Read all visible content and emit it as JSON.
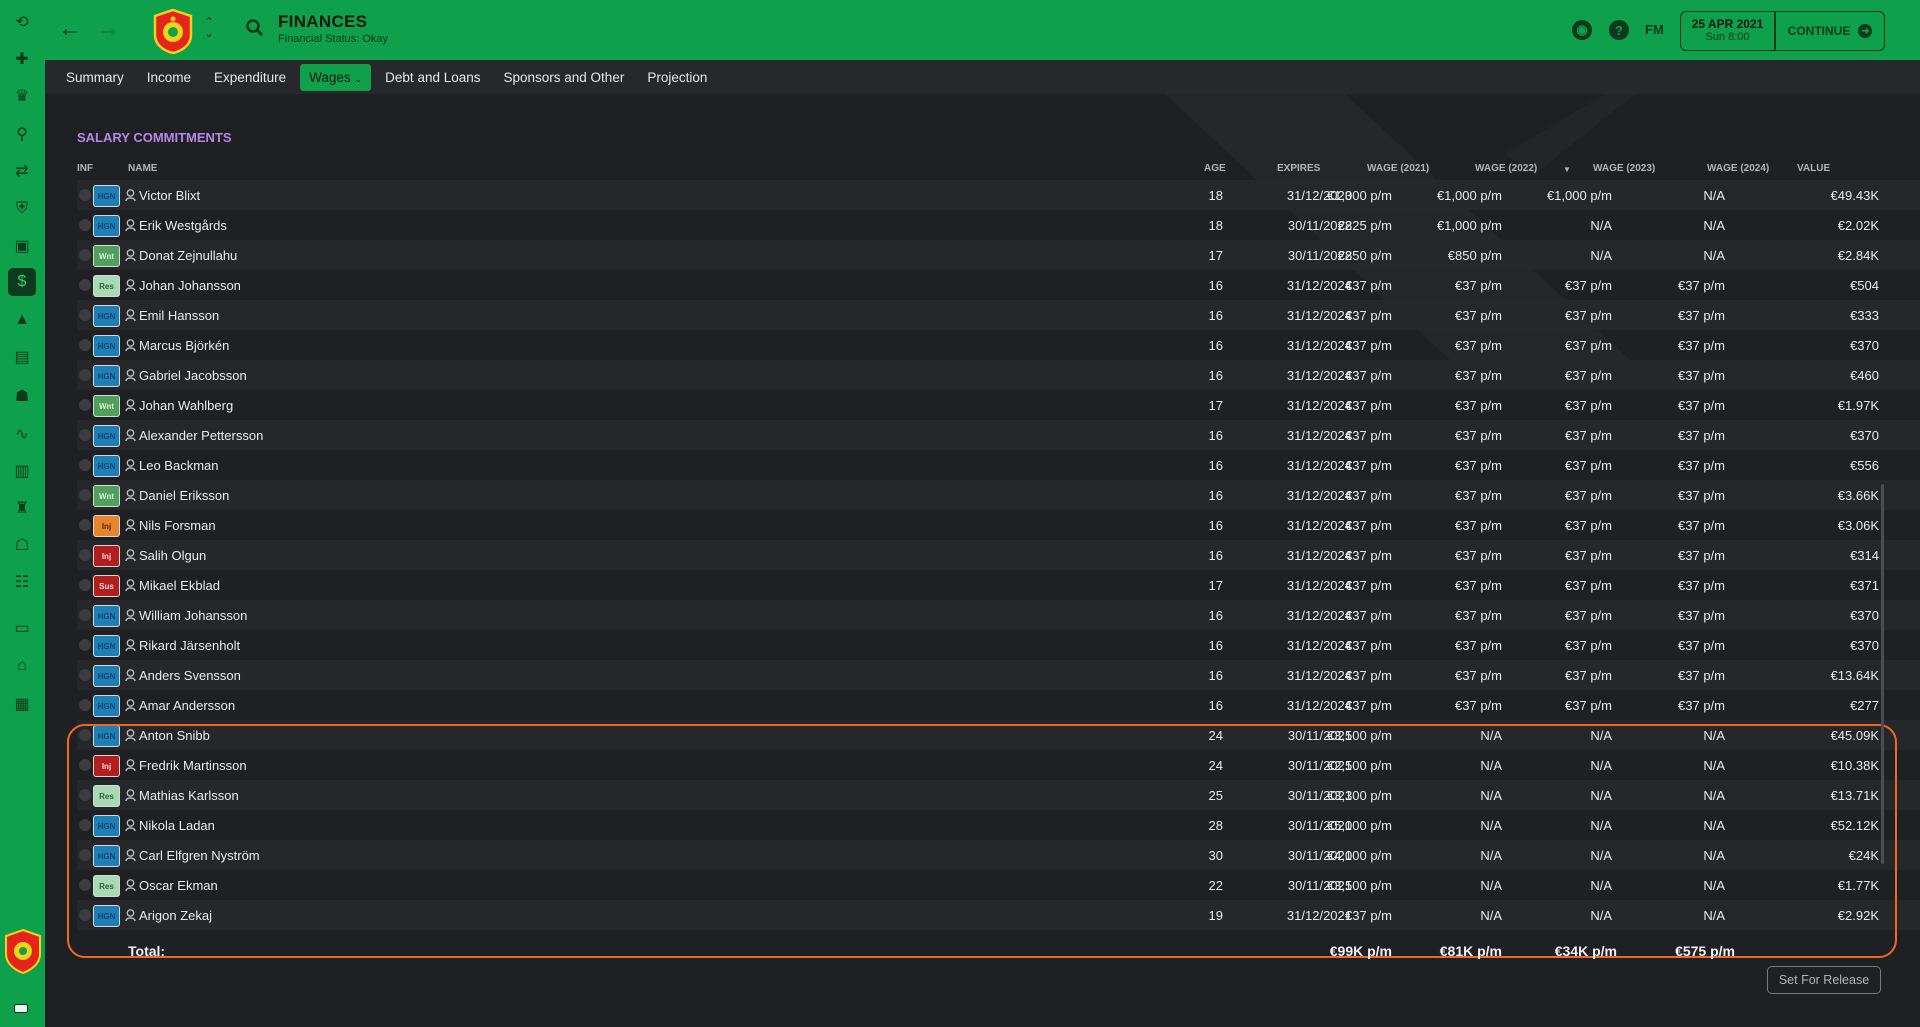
{
  "header": {
    "title": "FINANCES",
    "subtitle": "Financial Status: Okay",
    "fm_logo": "FM",
    "date": "25 APR 2021",
    "time": "Sun 8:00",
    "continue_label": "CONTINUE"
  },
  "tabs": [
    {
      "label": "Summary"
    },
    {
      "label": "Income"
    },
    {
      "label": "Expenditure"
    },
    {
      "label": "Wages"
    },
    {
      "label": "Debt and Loans"
    },
    {
      "label": "Sponsors and Other"
    },
    {
      "label": "Projection"
    }
  ],
  "section_title": "SALARY COMMITMENTS",
  "columns": {
    "inf": "INF",
    "name": "NAME",
    "age": "AGE",
    "expires": "EXPIRES",
    "w2021": "WAGE (2021)",
    "w2022": "WAGE (2022)",
    "w2023": "WAGE (2023)",
    "w2024": "WAGE (2024)",
    "value": "VALUE"
  },
  "rows": [
    {
      "badge": "HGN",
      "badge_type": "hgn",
      "name": "Victor Blixt",
      "age": "18",
      "expires": "31/12/2023",
      "w2021": "€1,000 p/m",
      "w2022": "€1,000 p/m",
      "w2023": "€1,000 p/m",
      "w2024": "N/A",
      "value": "€49.43K"
    },
    {
      "badge": "HGN",
      "badge_type": "hgn",
      "name": "Erik Westgårds",
      "age": "18",
      "expires": "30/11/2022",
      "w2021": "€825 p/m",
      "w2022": "€1,000 p/m",
      "w2023": "N/A",
      "w2024": "N/A",
      "value": "€2.02K"
    },
    {
      "badge": "Wnt",
      "badge_type": "wnt",
      "name": "Donat Zejnullahu",
      "age": "17",
      "expires": "30/11/2022",
      "w2021": "€850 p/m",
      "w2022": "€850 p/m",
      "w2023": "N/A",
      "w2024": "N/A",
      "value": "€2.84K"
    },
    {
      "badge": "Res",
      "badge_type": "res",
      "name": "Johan Johansson",
      "age": "16",
      "expires": "31/12/2024",
      "w2021": "€37 p/m",
      "w2022": "€37 p/m",
      "w2023": "€37 p/m",
      "w2024": "€37 p/m",
      "value": "€504"
    },
    {
      "badge": "HGN",
      "badge_type": "hgn",
      "name": "Emil Hansson",
      "age": "16",
      "expires": "31/12/2024",
      "w2021": "€37 p/m",
      "w2022": "€37 p/m",
      "w2023": "€37 p/m",
      "w2024": "€37 p/m",
      "value": "€333"
    },
    {
      "badge": "HGN",
      "badge_type": "hgn",
      "name": "Marcus Björkén",
      "age": "16",
      "expires": "31/12/2024",
      "w2021": "€37 p/m",
      "w2022": "€37 p/m",
      "w2023": "€37 p/m",
      "w2024": "€37 p/m",
      "value": "€370"
    },
    {
      "badge": "HGN",
      "badge_type": "hgn",
      "name": "Gabriel Jacobsson",
      "age": "16",
      "expires": "31/12/2024",
      "w2021": "€37 p/m",
      "w2022": "€37 p/m",
      "w2023": "€37 p/m",
      "w2024": "€37 p/m",
      "value": "€460"
    },
    {
      "badge": "Wnt",
      "badge_type": "wnt",
      "name": "Johan Wahlberg",
      "age": "17",
      "expires": "31/12/2024",
      "w2021": "€37 p/m",
      "w2022": "€37 p/m",
      "w2023": "€37 p/m",
      "w2024": "€37 p/m",
      "value": "€1.97K"
    },
    {
      "badge": "HGN",
      "badge_type": "hgn",
      "name": "Alexander Pettersson",
      "age": "16",
      "expires": "31/12/2024",
      "w2021": "€37 p/m",
      "w2022": "€37 p/m",
      "w2023": "€37 p/m",
      "w2024": "€37 p/m",
      "value": "€370"
    },
    {
      "badge": "HGN",
      "badge_type": "hgn",
      "name": "Leo Backman",
      "age": "16",
      "expires": "31/12/2024",
      "w2021": "€37 p/m",
      "w2022": "€37 p/m",
      "w2023": "€37 p/m",
      "w2024": "€37 p/m",
      "value": "€556"
    },
    {
      "badge": "Wnt",
      "badge_type": "wnt",
      "name": "Daniel Eriksson",
      "age": "16",
      "expires": "31/12/2024",
      "w2021": "€37 p/m",
      "w2022": "€37 p/m",
      "w2023": "€37 p/m",
      "w2024": "€37 p/m",
      "value": "€3.66K"
    },
    {
      "badge": "Inj",
      "badge_type": "injo",
      "name": "Nils Forsman",
      "age": "16",
      "expires": "31/12/2024",
      "w2021": "€37 p/m",
      "w2022": "€37 p/m",
      "w2023": "€37 p/m",
      "w2024": "€37 p/m",
      "value": "€3.06K"
    },
    {
      "badge": "Inj",
      "badge_type": "inj",
      "name": "Salih Olgun",
      "age": "16",
      "expires": "31/12/2024",
      "w2021": "€37 p/m",
      "w2022": "€37 p/m",
      "w2023": "€37 p/m",
      "w2024": "€37 p/m",
      "value": "€314"
    },
    {
      "badge": "Sus",
      "badge_type": "sus",
      "name": "Mikael Ekblad",
      "age": "17",
      "expires": "31/12/2024",
      "w2021": "€37 p/m",
      "w2022": "€37 p/m",
      "w2023": "€37 p/m",
      "w2024": "€37 p/m",
      "value": "€371"
    },
    {
      "badge": "HGN",
      "badge_type": "hgn",
      "name": "William Johansson",
      "age": "16",
      "expires": "31/12/2024",
      "w2021": "€37 p/m",
      "w2022": "€37 p/m",
      "w2023": "€37 p/m",
      "w2024": "€37 p/m",
      "value": "€370"
    },
    {
      "badge": "HGN",
      "badge_type": "hgn",
      "name": "Rikard Järsenholt",
      "age": "16",
      "expires": "31/12/2024",
      "w2021": "€37 p/m",
      "w2022": "€37 p/m",
      "w2023": "€37 p/m",
      "w2024": "€37 p/m",
      "value": "€370"
    },
    {
      "badge": "HGN",
      "badge_type": "hgn",
      "name": "Anders Svensson",
      "age": "16",
      "expires": "31/12/2024",
      "w2021": "€37 p/m",
      "w2022": "€37 p/m",
      "w2023": "€37 p/m",
      "w2024": "€37 p/m",
      "value": "€13.64K"
    },
    {
      "badge": "HGN",
      "badge_type": "hgn",
      "name": "Amar Andersson",
      "age": "16",
      "expires": "31/12/2024",
      "w2021": "€37 p/m",
      "w2022": "€37 p/m",
      "w2023": "€37 p/m",
      "w2024": "€37 p/m",
      "value": "€277"
    },
    {
      "badge": "HGN",
      "badge_type": "hgn",
      "name": "Anton Snibb",
      "age": "24",
      "expires": "30/11/2021",
      "w2021": "€3,500 p/m",
      "w2022": "N/A",
      "w2023": "N/A",
      "w2024": "N/A",
      "value": "€45.09K"
    },
    {
      "badge": "Inj",
      "badge_type": "inj",
      "name": "Fredrik Martinsson",
      "age": "24",
      "expires": "30/11/2021",
      "w2021": "€2,500 p/m",
      "w2022": "N/A",
      "w2023": "N/A",
      "w2024": "N/A",
      "value": "€10.38K"
    },
    {
      "badge": "Res",
      "badge_type": "res",
      "name": "Mathias Karlsson",
      "age": "25",
      "expires": "30/11/2021",
      "w2021": "€3,300 p/m",
      "w2022": "N/A",
      "w2023": "N/A",
      "w2024": "N/A",
      "value": "€13.71K"
    },
    {
      "badge": "HGN",
      "badge_type": "hgn",
      "name": "Nikola Ladan",
      "age": "28",
      "expires": "30/11/2021",
      "w2021": "€5,000 p/m",
      "w2022": "N/A",
      "w2023": "N/A",
      "w2024": "N/A",
      "value": "€52.12K"
    },
    {
      "badge": "HGN",
      "badge_type": "hgn",
      "name": "Carl Elfgren Nyström",
      "age": "30",
      "expires": "30/11/2021",
      "w2021": "€4,000 p/m",
      "w2022": "N/A",
      "w2023": "N/A",
      "w2024": "N/A",
      "value": "€24K"
    },
    {
      "badge": "Res",
      "badge_type": "res",
      "name": "Oscar Ekman",
      "age": "22",
      "expires": "30/11/2021",
      "w2021": "€3,500 p/m",
      "w2022": "N/A",
      "w2023": "N/A",
      "w2024": "N/A",
      "value": "€1.77K"
    },
    {
      "badge": "HGN",
      "badge_type": "hgn",
      "name": "Arigon Zekaj",
      "age": "19",
      "expires": "31/12/2021",
      "w2021": "€37 p/m",
      "w2022": "N/A",
      "w2023": "N/A",
      "w2024": "N/A",
      "value": "€2.92K"
    }
  ],
  "total": {
    "label": "Total:",
    "w2021": "€99K p/m",
    "w2022": "€81K p/m",
    "w2023": "€34K p/m",
    "w2024": "€575 p/m"
  },
  "set_release_label": "Set For Release",
  "colors": {
    "brand_green": "#0ea04b",
    "background": "#1f2024",
    "section_title": "#b886e6",
    "highlight": "#f06a1e"
  }
}
